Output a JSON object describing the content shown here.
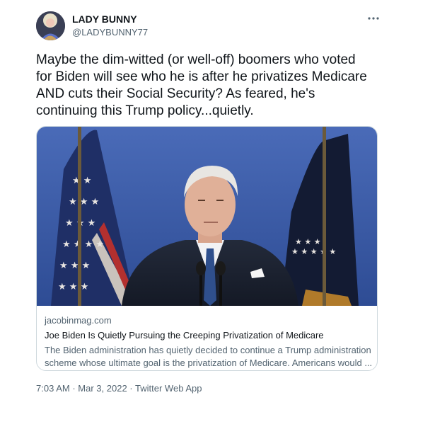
{
  "author": {
    "display_name": "LADY BUNNY",
    "handle": "@LADYBUNNY77",
    "avatar_icon": "avatar-photo"
  },
  "more_icon": "more-dots-icon",
  "tweet": {
    "text_lines": [
      "Maybe the dim-witted (or well-off) boomers who voted",
      "for Biden will see who he is after he privatizes Medicare",
      "AND cuts their Social Security? As feared, he's",
      "continuing this Trump policy...quietly."
    ]
  },
  "card": {
    "domain": "jacobinmag.com",
    "title": "Joe Biden Is Quietly Pursuing the Creeping Privatization of Medicare",
    "description_lines": [
      "The Biden administration has quietly decided to continue a Trump administration",
      "scheme whose ultimate goal is the privatization of Medicare. Americans would ..."
    ]
  },
  "meta": {
    "time": "7:03 AM",
    "separator": "·",
    "date": "Mar 3, 2022",
    "source": "Twitter Web App"
  },
  "colors": {
    "text": "#0f1419",
    "secondary": "#536471",
    "border": "#cfd9de",
    "image_background": "#3f5fa8"
  }
}
